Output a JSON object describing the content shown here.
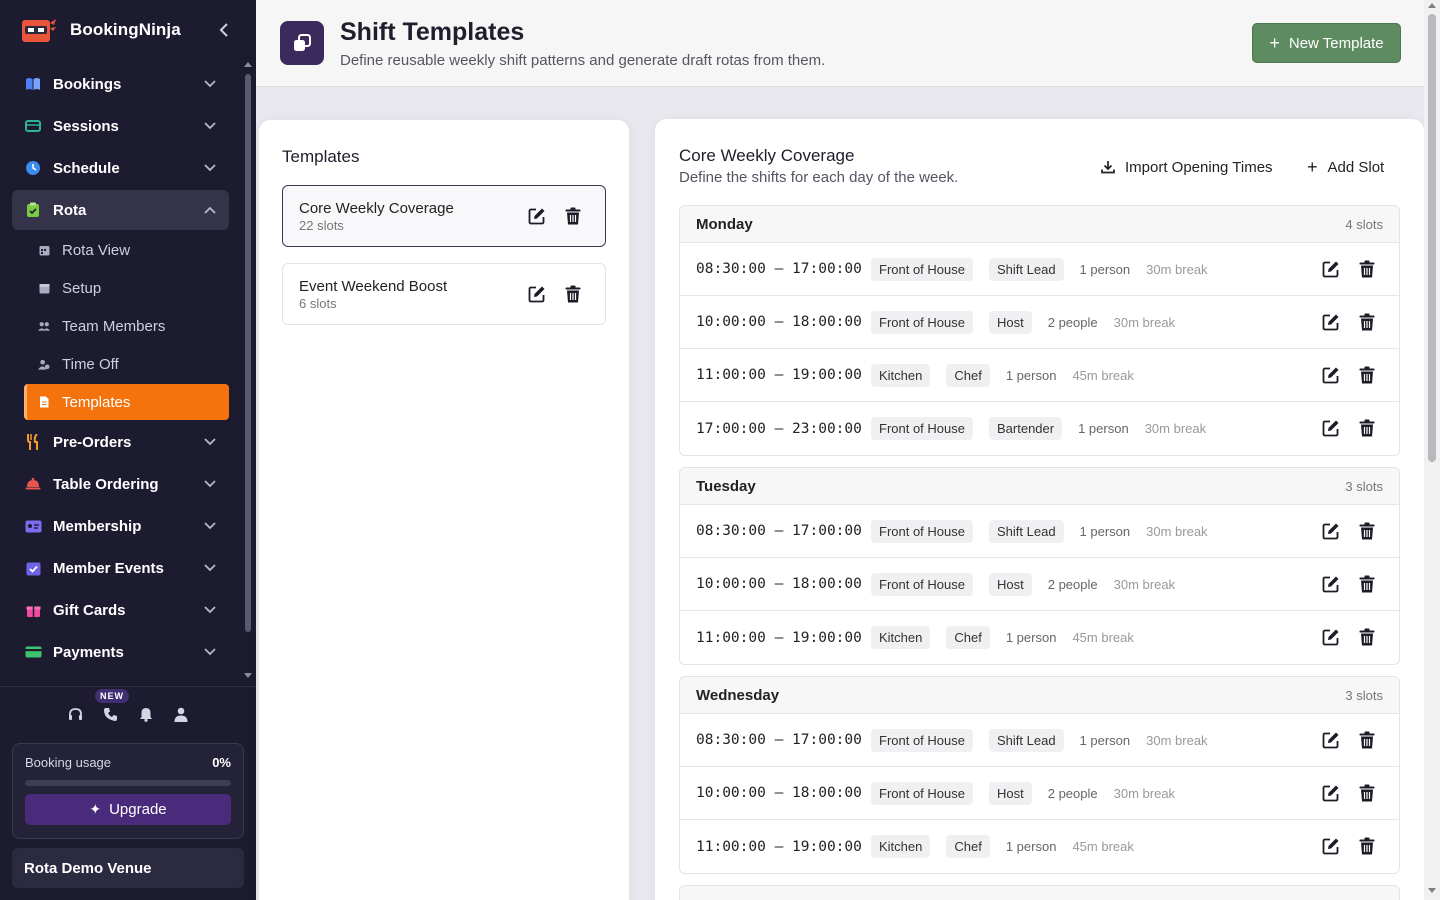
{
  "brand": {
    "name": "BookingNinja"
  },
  "sidebar": {
    "items": [
      {
        "label": "Bookings",
        "icon": "book-icon",
        "color": "#4f7ef0",
        "open": false
      },
      {
        "label": "Sessions",
        "icon": "ticket-icon",
        "color": "#2fb39a",
        "open": false
      },
      {
        "label": "Schedule",
        "icon": "clock-icon",
        "color": "#3c8bf0",
        "open": false
      },
      {
        "label": "Rota",
        "icon": "clipboard-check-icon",
        "color": "#7ac943",
        "open": true
      },
      {
        "label": "Pre-Orders",
        "icon": "utensils-icon",
        "color": "#f59b2a",
        "open": false
      },
      {
        "label": "Table Ordering",
        "icon": "cloche-icon",
        "color": "#e9554f",
        "open": false
      },
      {
        "label": "Membership",
        "icon": "id-card-icon",
        "color": "#7b6cf0",
        "open": false
      },
      {
        "label": "Member Events",
        "icon": "calendar-check-icon",
        "color": "#6f63e8",
        "open": false
      },
      {
        "label": "Gift Cards",
        "icon": "gift-icon",
        "color": "#f04aa0",
        "open": false
      },
      {
        "label": "Payments",
        "icon": "credit-card-icon",
        "color": "#3fc46e",
        "open": false
      }
    ],
    "rota_sub": [
      {
        "label": "Rota View",
        "icon": "calendar-grid-icon"
      },
      {
        "label": "Setup",
        "icon": "calendar-icon"
      },
      {
        "label": "Team Members",
        "icon": "users-icon"
      },
      {
        "label": "Time Off",
        "icon": "user-clock-icon"
      },
      {
        "label": "Templates",
        "icon": "file-icon",
        "active": true
      }
    ],
    "quick_icons": [
      "headset-icon",
      "phone-icon",
      "bell-icon",
      "user-icon"
    ],
    "new_badge": "NEW",
    "usage": {
      "label": "Booking usage",
      "percent_text": "0%",
      "fraction": 0
    },
    "upgrade_label": "Upgrade",
    "venue": "Rota Demo Venue"
  },
  "header": {
    "title": "Shift Templates",
    "subtitle": "Define reusable weekly shift patterns and generate draft rotas from them.",
    "new_button": "New Template"
  },
  "templates_panel": {
    "heading": "Templates",
    "templates": [
      {
        "name": "Core Weekly Coverage",
        "slots": "22 slots",
        "selected": true
      },
      {
        "name": "Event Weekend Boost",
        "slots": "6 slots",
        "selected": false
      }
    ]
  },
  "editor": {
    "title": "Core Weekly Coverage",
    "subtitle": "Define the shifts for each day of the week.",
    "import_label": "Import Opening Times",
    "add_label": "Add Slot",
    "days": [
      {
        "name": "Monday",
        "count": "4 slots",
        "slots": [
          {
            "time": "08:30:00 – 17:00:00",
            "area": "Front of House",
            "role": "Shift Lead",
            "people": "1 person",
            "break": "30m break"
          },
          {
            "time": "10:00:00 – 18:00:00",
            "area": "Front of House",
            "role": "Host",
            "people": "2 people",
            "break": "30m break"
          },
          {
            "time": "11:00:00 – 19:00:00",
            "area": "Kitchen",
            "role": "Chef",
            "people": "1 person",
            "break": "45m break"
          },
          {
            "time": "17:00:00 – 23:00:00",
            "area": "Front of House",
            "role": "Bartender",
            "people": "1 person",
            "break": "30m break"
          }
        ]
      },
      {
        "name": "Tuesday",
        "count": "3 slots",
        "slots": [
          {
            "time": "08:30:00 – 17:00:00",
            "area": "Front of House",
            "role": "Shift Lead",
            "people": "1 person",
            "break": "30m break"
          },
          {
            "time": "10:00:00 – 18:00:00",
            "area": "Front of House",
            "role": "Host",
            "people": "2 people",
            "break": "30m break"
          },
          {
            "time": "11:00:00 – 19:00:00",
            "area": "Kitchen",
            "role": "Chef",
            "people": "1 person",
            "break": "45m break"
          }
        ]
      },
      {
        "name": "Wednesday",
        "count": "3 slots",
        "slots": [
          {
            "time": "08:30:00 – 17:00:00",
            "area": "Front of House",
            "role": "Shift Lead",
            "people": "1 person",
            "break": "30m break"
          },
          {
            "time": "10:00:00 – 18:00:00",
            "area": "Front of House",
            "role": "Host",
            "people": "2 people",
            "break": "30m break"
          },
          {
            "time": "11:00:00 – 19:00:00",
            "area": "Kitchen",
            "role": "Chef",
            "people": "1 person",
            "break": "45m break"
          }
        ]
      }
    ]
  },
  "colors": {
    "accent_orange": "#f5730c",
    "sidebar_bg": "#1c1b30",
    "green_button": "#5e8b5f",
    "upgrade_purple": "#4a2a7a"
  }
}
